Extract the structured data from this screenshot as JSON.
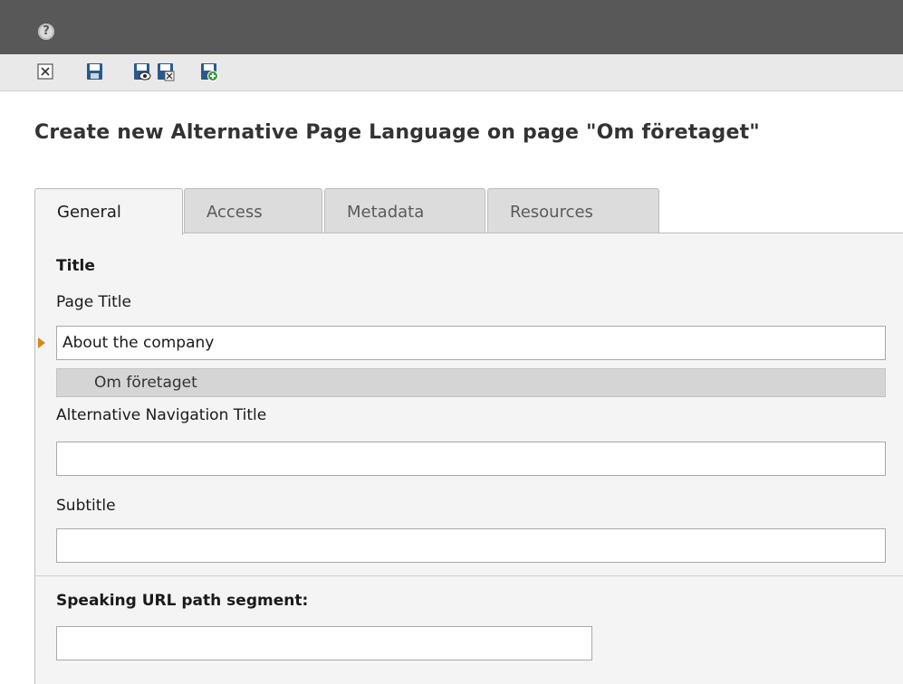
{
  "header": {
    "help_icon": "help-icon"
  },
  "toolbar": {
    "buttons": [
      {
        "name": "close-document",
        "icon": "close-icon"
      },
      {
        "name": "save-document",
        "icon": "save-icon"
      },
      {
        "name": "save-and-view",
        "icon": "save-view-icon"
      },
      {
        "name": "save-and-close",
        "icon": "save-close-icon"
      },
      {
        "name": "save-and-new",
        "icon": "save-new-icon"
      }
    ]
  },
  "page": {
    "title": "Create new Alternative Page Language on page \"Om företaget\""
  },
  "tabs": [
    {
      "label": "General",
      "active": true
    },
    {
      "label": "Access",
      "active": false
    },
    {
      "label": "Metadata",
      "active": false
    },
    {
      "label": "Resources",
      "active": false
    }
  ],
  "form": {
    "section_title": "Title",
    "page_title_label": "Page Title",
    "page_title_value": "About the company",
    "page_title_original": "Om företaget",
    "nav_title_label": "Alternative Navigation Title",
    "nav_title_value": "",
    "subtitle_label": "Subtitle",
    "subtitle_value": "",
    "url_segment_label": "Speaking URL path segment:",
    "url_segment_value": ""
  },
  "colors": {
    "topbar": "#585858",
    "toolbar": "#e9e9e9",
    "panel": "#f4f4f4",
    "marker": "#d48a17",
    "save_icon": "#2b5a8a",
    "add_badge": "#3a9a3a"
  }
}
